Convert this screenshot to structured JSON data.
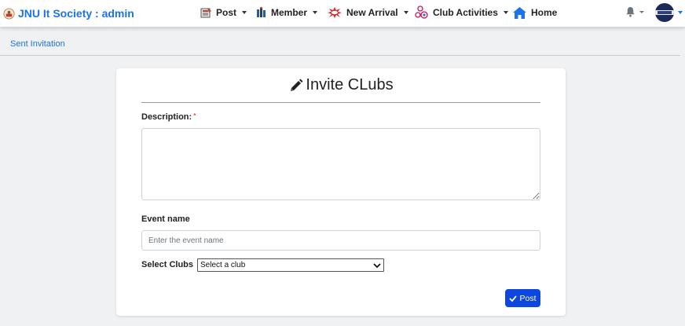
{
  "app": {
    "brand_title": "JNU It Society : admin"
  },
  "nav": {
    "post_label": "Post",
    "member_label": "Member",
    "new_arrival_label": "New Arrival",
    "club_activities_label": "Club Activities",
    "home_label": "Home"
  },
  "breadcrumb": {
    "current": "Sent Invitation"
  },
  "form": {
    "title": "Invite CLubs",
    "description_label": "Description:",
    "required_marker": "*",
    "description_value": "",
    "event_name_label": "Event name",
    "event_name_value": "",
    "event_name_placeholder": "Enter the event name",
    "clubs_label": "Select Clubs",
    "clubs_selected": "Select a club",
    "submit_label": "Post"
  },
  "colors": {
    "brand": "#1a73e8",
    "primary_button": "#0d47e0",
    "page_background": "#f0f1f3"
  },
  "icons": {
    "brand": "society-logo-icon",
    "post": "newspaper-icon",
    "member": "members-icon",
    "new_arrival": "burst-icon",
    "club_activities": "activities-icon",
    "home": "home-icon",
    "notifications": "bell-icon",
    "title": "pencil-icon",
    "submit": "check-icon"
  }
}
